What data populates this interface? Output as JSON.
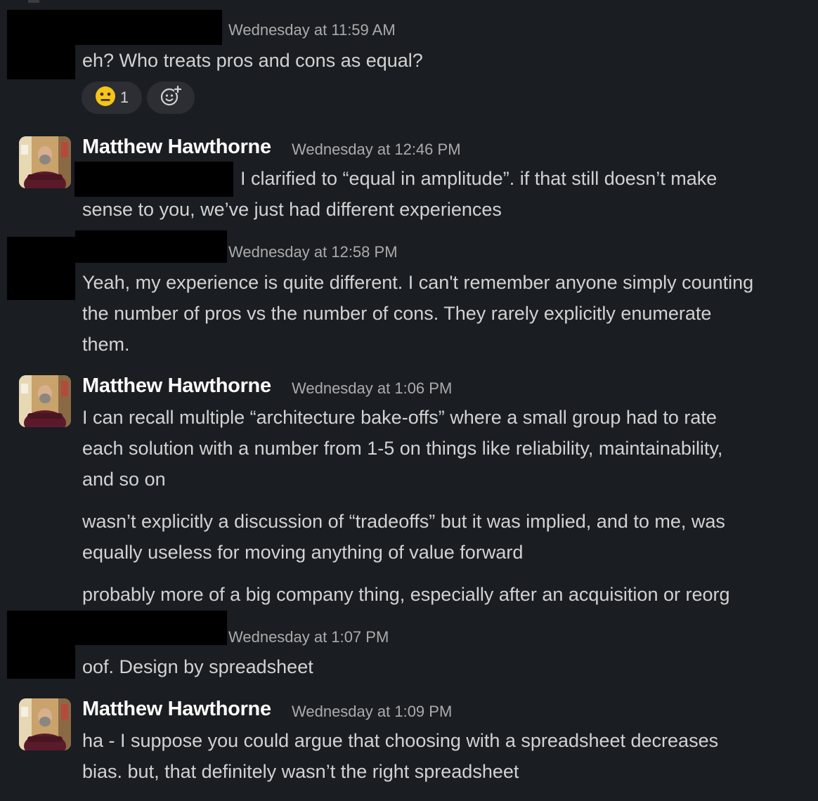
{
  "messages": [
    {
      "author": "",
      "timestamp": "Wednesday at 11:59 AM",
      "lines": [
        "eh? Who treats pros and cons as equal?"
      ],
      "reactions": [
        {
          "emoji": "neutral-face-icon",
          "count": "1"
        }
      ]
    },
    {
      "author": "Matthew Hawthorne",
      "timestamp": "Wednesday at 12:46 PM",
      "lines": [
        "I clarified to “equal in amplitude”.  if that still doesn’t make",
        "sense to you, we’ve just had different experiences"
      ]
    },
    {
      "author": "",
      "timestamp": "Wednesday at 12:58 PM",
      "lines": [
        "Yeah, my experience is quite different. I can't remember anyone simply counting",
        "the number of pros vs the number of cons. They rarely explicitly enumerate",
        "them."
      ]
    },
    {
      "author": "Matthew Hawthorne",
      "timestamp": "Wednesday at 1:06 PM",
      "lines": [
        "I can recall multiple “architecture bake-offs” where a small group had to rate",
        "each solution with a number from 1-5 on things like reliability, maintainability,",
        "and so on"
      ],
      "paragraph2": [
        "wasn’t explicitly a discussion of “tradeoffs” but it was implied, and to me, was",
        "equally useless for moving anything of value forward"
      ],
      "paragraph3": [
        "probably more of a big company thing, especially after an acquisition or reorg"
      ]
    },
    {
      "author": "",
      "timestamp": "Wednesday at 1:07 PM",
      "lines": [
        "oof. Design by spreadsheet"
      ]
    },
    {
      "author": "Matthew Hawthorne",
      "timestamp": "Wednesday at 1:09 PM",
      "lines": [
        "ha - I suppose you could argue that choosing with a spreadsheet decreases",
        "bias.  but, that definitely wasn’t the right spreadsheet"
      ]
    }
  ],
  "colors": {
    "background": "#1a1d21",
    "text": "#d1d2d3",
    "author": "#ffffff",
    "timestamp": "#ababad",
    "reaction_bg": "#2c2e33",
    "redaction": "#000000"
  }
}
